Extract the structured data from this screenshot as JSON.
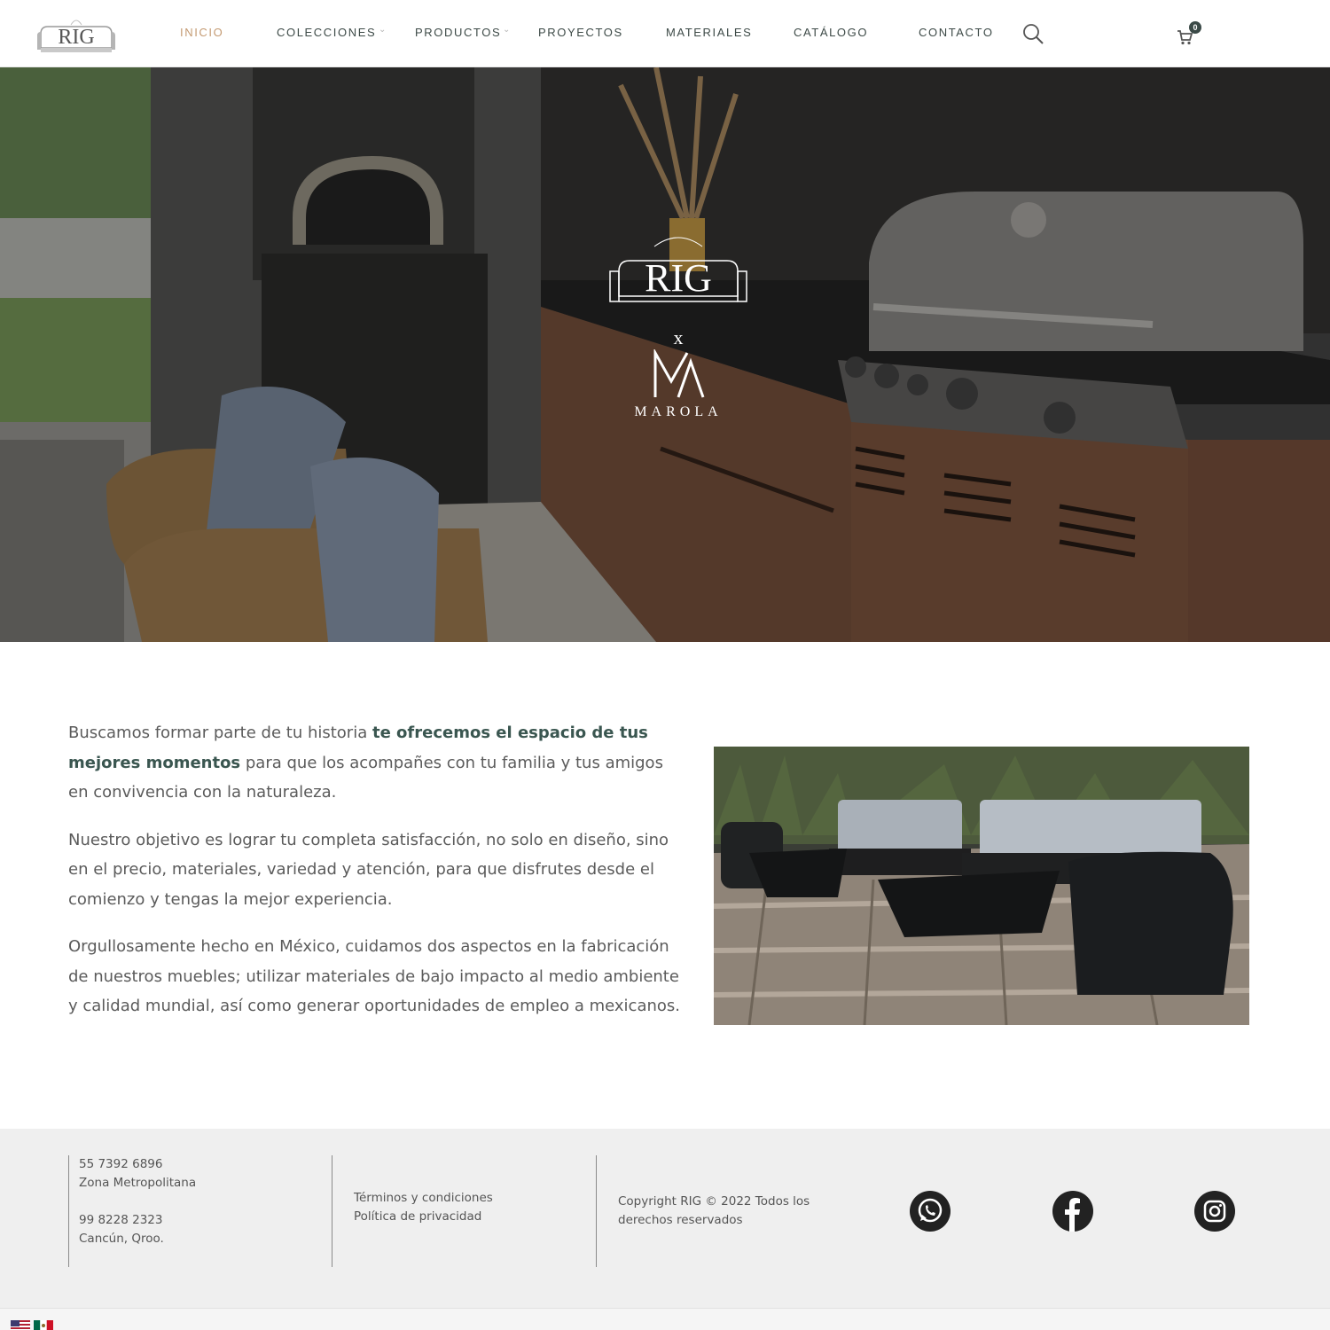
{
  "header": {
    "logo_text": "RIG",
    "nav": [
      {
        "label": "INICIO",
        "active": true
      },
      {
        "label": "COLECCIONES",
        "has_dropdown": true
      },
      {
        "label": "PRODUCTOS",
        "has_dropdown": true
      },
      {
        "label": "PROYECTOS"
      },
      {
        "label": "MATERIALES"
      },
      {
        "label": "CATÁLOGO"
      },
      {
        "label": "CONTACTO"
      }
    ],
    "search_icon": "search-icon",
    "cart_icon": "cart-icon",
    "cart_count": "0"
  },
  "hero": {
    "brand_logo": "RIG",
    "separator": "x",
    "partner_mark": "MA",
    "partner_name": "MAROLA"
  },
  "intro": {
    "p1_a": "Buscamos formar parte de tu historia ",
    "p1_b": "te ofrecemos el espacio de tus mejores momentos",
    "p1_c": " para que los acompañes con tu familia y tus amigos en convivencia con la naturaleza.",
    "p2": "Nuestro objetivo es lograr tu completa satisfacción, no solo en diseño, sino en el precio, materiales, variedad y atención, para que disfrutes desde el comienzo y tengas la mejor experiencia.",
    "p3": "Orgullosamente hecho en México, cuidamos dos aspectos en la fabricación de nuestros muebles; utilizar materiales de bajo impacto al medio ambiente y calidad mundial,  así como  generar oportunidades de empleo a mexicanos."
  },
  "footer": {
    "contact": {
      "phone1": "55 7392 6896",
      "area1": "Zona Metropolitana",
      "phone2": "99 8228 2323",
      "area2": "Cancún, Qroo."
    },
    "links": {
      "terms": "Términos y condiciones",
      "privacy": "Política de privacidad"
    },
    "copyright_1": "Copyright RIG © 2022 Todos los",
    "copyright_2": "derechos reservados",
    "social": [
      "whatsapp-icon",
      "facebook-icon",
      "instagram-icon"
    ]
  },
  "languages": [
    "English",
    "Español"
  ],
  "colors": {
    "accent": "#c49a72",
    "brand_green": "#3a5650",
    "footer_bg": "#efefef"
  }
}
